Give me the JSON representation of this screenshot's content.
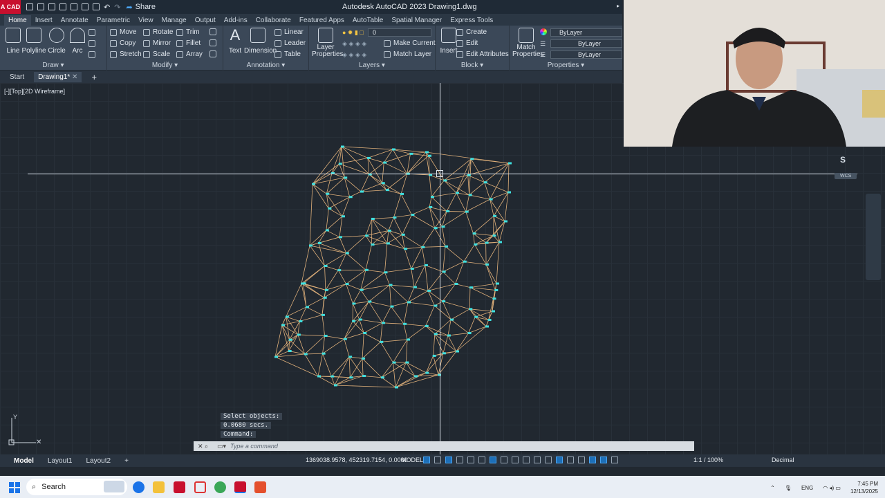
{
  "app": {
    "logo": "A CAD",
    "title": "Autodesk AutoCAD 2023   Drawing1.dwg",
    "share_label": "Share"
  },
  "ribbon_tabs": [
    "Home",
    "Insert",
    "Annotate",
    "Parametric",
    "View",
    "Manage",
    "Output",
    "Add-ins",
    "Collaborate",
    "Featured Apps",
    "AutoTable",
    "Spatial Manager",
    "Express Tools"
  ],
  "groups": {
    "draw": {
      "title": "Draw",
      "line": "Line",
      "polyline": "Polyline",
      "circle": "Circle",
      "arc": "Arc"
    },
    "modify": {
      "title": "Modify",
      "move": "Move",
      "rotate": "Rotate",
      "trim": "Trim",
      "copy": "Copy",
      "mirror": "Mirror",
      "fillet": "Fillet",
      "stretch": "Stretch",
      "scale": "Scale",
      "array": "Array"
    },
    "annotation": {
      "title": "Annotation",
      "text": "Text",
      "dimension": "Dimension",
      "linear": "Linear",
      "leader": "Leader",
      "table": "Table"
    },
    "layers": {
      "title": "Layers",
      "properties": "Layer Properties",
      "current_layer": "0",
      "make_current": "Make Current",
      "match_layer": "Match Layer"
    },
    "block": {
      "title": "Block",
      "insert": "Insert",
      "create": "Create",
      "edit": "Edit",
      "edit_attributes": "Edit Attributes"
    },
    "properties": {
      "title": "Properties",
      "match": "Match Properties",
      "color": "ByLayer",
      "linetype": "ByLayer",
      "lineweight": "ByLayer"
    }
  },
  "file_tabs": {
    "start": "Start",
    "drawing": "Drawing1*",
    "new_tab": "+"
  },
  "viewport": {
    "label": "[-][Top][2D Wireframe]",
    "wcs": "WCS",
    "compass": "S"
  },
  "command": {
    "history": [
      "Select objects:",
      "0.0680 secs.",
      "Command:"
    ],
    "placeholder": "Type a command"
  },
  "status": {
    "layout_tabs": [
      "Model",
      "Layout1",
      "Layout2"
    ],
    "coordinates": "1369038.9578, 452319.7154, 0.0000",
    "model": "MODEL",
    "scale": "1:1 / 100%",
    "units": "Decimal"
  },
  "taskbar": {
    "search": "Search",
    "lang": "ENG",
    "time": "7:45 PM",
    "date": "12/13/2025"
  },
  "colors": {
    "tin_lines": "#e0b07a",
    "points": "#3fe0e0",
    "accent": "#1d6fb8"
  }
}
